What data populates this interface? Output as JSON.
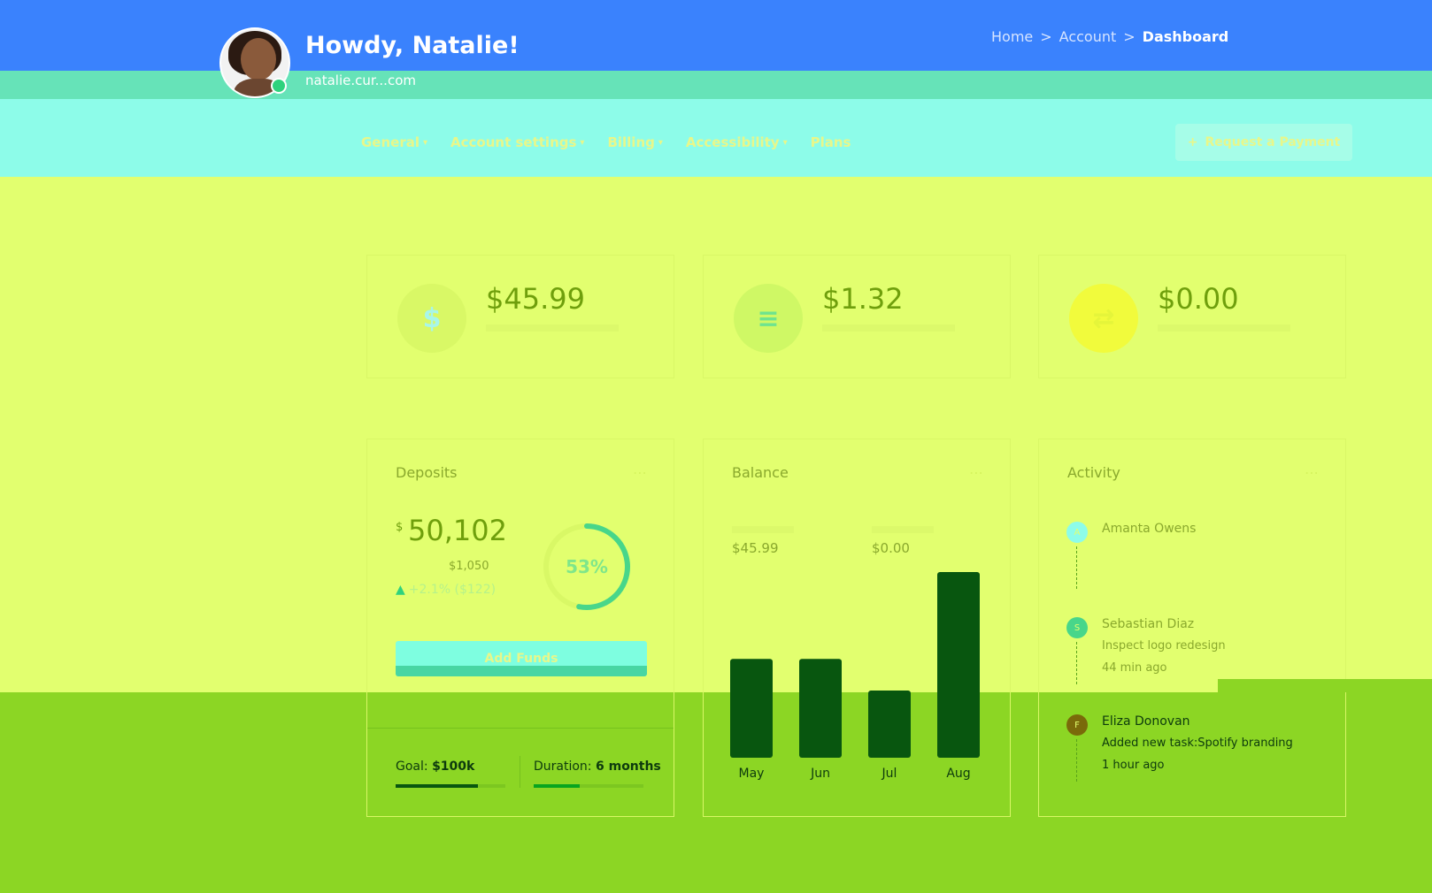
{
  "header": {
    "greeting": "Howdy, Natalie!",
    "email": "natalie.cur...com",
    "breadcrumb": [
      "Home",
      "Account",
      "Dashboard"
    ]
  },
  "nav": {
    "items": [
      {
        "label": "General"
      },
      {
        "label": "Account settings"
      },
      {
        "label": "Billing"
      },
      {
        "label": "Accessibility"
      },
      {
        "label": "Plans"
      }
    ],
    "request_button": "Request a Payment"
  },
  "stats": [
    {
      "value": "$45.99",
      "icon": "dollar-icon",
      "glyph": "$",
      "icon_bg": "#d9f866",
      "icon_color": "#a8f6e8"
    },
    {
      "value": "$1.32",
      "icon": "coins-icon",
      "glyph": "≡",
      "icon_bg": "#cff865",
      "icon_color": "#6ee38f"
    },
    {
      "value": "$0.00",
      "icon": "exchange-icon",
      "glyph": "⇄",
      "icon_bg": "#f1fb3c",
      "icon_color": "#e5f53a"
    }
  ],
  "deposits": {
    "title": "Deposits",
    "currency": "$",
    "amount": "50,102",
    "sub": "$1,050",
    "growth": "+2.1% ($122)",
    "ring_percent": 53,
    "ring_label": "53%",
    "button": "Add Funds",
    "goal_label": "Goal:",
    "goal_value": "$100k",
    "goal_progress": 0.75,
    "duration_label": "Duration:",
    "duration_value": "6 months",
    "duration_progress": 0.42
  },
  "balance": {
    "title": "Balance",
    "values": [
      "$45.99",
      "$0.00"
    ]
  },
  "chart_data": {
    "type": "bar",
    "categories": [
      "May",
      "Jun",
      "Jul",
      "Aug"
    ],
    "values": [
      100,
      100,
      68,
      188
    ],
    "colors": {
      "bar": "#08560f",
      "accent": "#48d6a3",
      "highlight": "#8dfce9"
    },
    "title": "",
    "xlabel": "",
    "ylabel": ""
  },
  "activity": {
    "title": "Activity",
    "items": [
      {
        "initial": "A",
        "name": "Amanta Owens",
        "desc": "",
        "time": "",
        "dot_bg": "#8dfce9",
        "text_color": "#8aa92d"
      },
      {
        "initial": "S",
        "name": "Sebastian Diaz",
        "desc": "Inspect logo redesign",
        "time": "44 min ago",
        "dot_bg": "#48d68a",
        "text_color": "#8aa92d"
      },
      {
        "initial": "F",
        "name": "Eliza Donovan",
        "desc": "Added new task:Spotify branding",
        "time": "1 hour ago",
        "dot_bg": "#7a6a0a",
        "text_color": "#0d3b0d"
      }
    ]
  }
}
